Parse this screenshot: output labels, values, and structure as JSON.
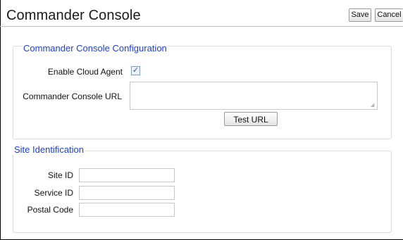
{
  "header": {
    "title": "Commander Console",
    "save_label": "Save",
    "cancel_label": "Cancel"
  },
  "config_section": {
    "legend": "Commander Console Configuration",
    "enable_cloud_agent_label": "Enable Cloud Agent",
    "enable_cloud_agent_checked": true,
    "checkbox_glyph": "✓",
    "console_url_label": "Commander Console URL",
    "console_url_value": "",
    "test_url_label": "Test URL"
  },
  "site_section": {
    "legend": "Site Identification",
    "site_id_label": "Site ID",
    "site_id_value": "",
    "service_id_label": "Service ID",
    "service_id_value": "",
    "postal_code_label": "Postal Code",
    "postal_code_value": ""
  },
  "colors": {
    "legend_text": "#1f3fcf",
    "panel_border": "#dcdcdc"
  }
}
